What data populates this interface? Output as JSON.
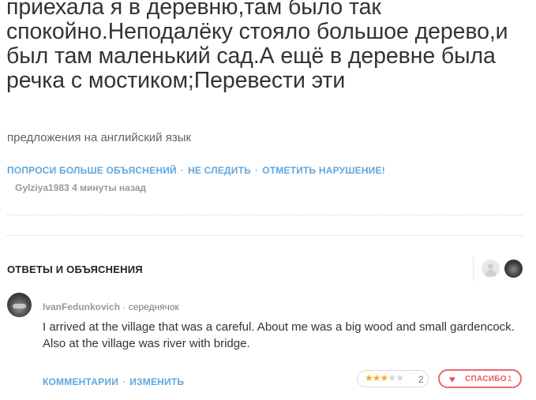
{
  "question": {
    "text": "приехала я в деревню,там было так спокойно.Неподалёку стояло большое дерево,и был там маленький сад.А ещё в деревне была речка с мостиком;Перевести эти",
    "subtext": "предложения на английский язык",
    "actions": [
      "ПОПРОСИ БОЛЬШЕ ОБЪЯСНЕНИЙ",
      "НЕ СЛЕДИТЬ",
      "ОТМЕТИТЬ НАРУШЕНИЕ!"
    ],
    "separator": "·",
    "author": "Gylziya1983",
    "time": "4 минуты назад"
  },
  "answers_section": {
    "title": "ОТВЕТЫ И ОБЪЯСНЕНИЯ"
  },
  "answer": {
    "author": "IvanFedunkovich",
    "rank": "середнячок",
    "text": "I arrived at the village that was a careful. About me was a big wood and small gardencock. Also at the village was river with bridge.",
    "actions": [
      "КОММЕНТАРИИ",
      "ИЗМЕНИТЬ"
    ],
    "rating_stars": 3,
    "rating_max": 5,
    "rating_count": "2",
    "thanks_label": "СПАСИБО",
    "thanks_count": "1",
    "colors": {
      "accent": "#5fa7dd",
      "thanks": "#f0666b",
      "star": "#f2b01e"
    }
  }
}
